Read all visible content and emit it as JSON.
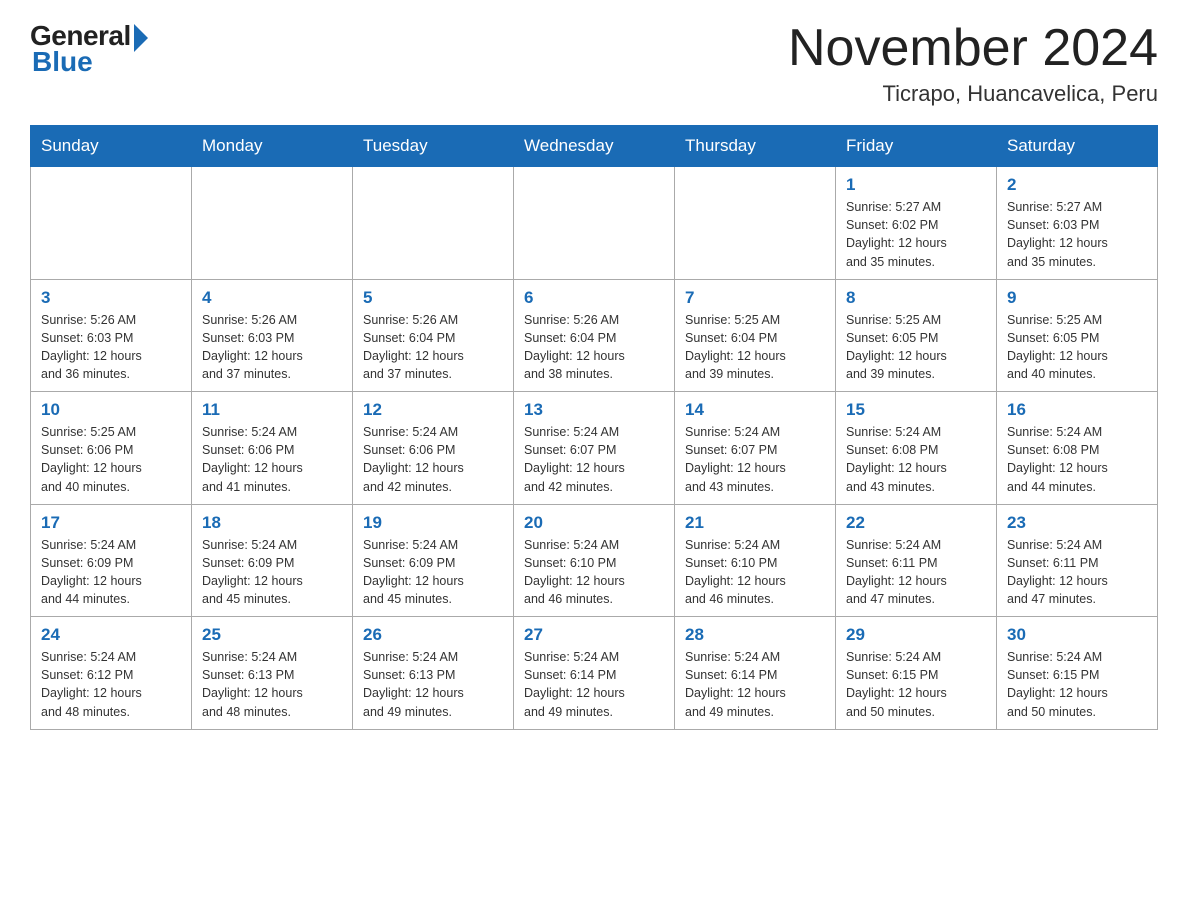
{
  "header": {
    "logo_general": "General",
    "logo_blue": "Blue",
    "month_year": "November 2024",
    "location": "Ticrapo, Huancavelica, Peru"
  },
  "weekdays": [
    "Sunday",
    "Monday",
    "Tuesday",
    "Wednesday",
    "Thursday",
    "Friday",
    "Saturday"
  ],
  "weeks": [
    [
      {
        "day": "",
        "info": ""
      },
      {
        "day": "",
        "info": ""
      },
      {
        "day": "",
        "info": ""
      },
      {
        "day": "",
        "info": ""
      },
      {
        "day": "",
        "info": ""
      },
      {
        "day": "1",
        "info": "Sunrise: 5:27 AM\nSunset: 6:02 PM\nDaylight: 12 hours\nand 35 minutes."
      },
      {
        "day": "2",
        "info": "Sunrise: 5:27 AM\nSunset: 6:03 PM\nDaylight: 12 hours\nand 35 minutes."
      }
    ],
    [
      {
        "day": "3",
        "info": "Sunrise: 5:26 AM\nSunset: 6:03 PM\nDaylight: 12 hours\nand 36 minutes."
      },
      {
        "day": "4",
        "info": "Sunrise: 5:26 AM\nSunset: 6:03 PM\nDaylight: 12 hours\nand 37 minutes."
      },
      {
        "day": "5",
        "info": "Sunrise: 5:26 AM\nSunset: 6:04 PM\nDaylight: 12 hours\nand 37 minutes."
      },
      {
        "day": "6",
        "info": "Sunrise: 5:26 AM\nSunset: 6:04 PM\nDaylight: 12 hours\nand 38 minutes."
      },
      {
        "day": "7",
        "info": "Sunrise: 5:25 AM\nSunset: 6:04 PM\nDaylight: 12 hours\nand 39 minutes."
      },
      {
        "day": "8",
        "info": "Sunrise: 5:25 AM\nSunset: 6:05 PM\nDaylight: 12 hours\nand 39 minutes."
      },
      {
        "day": "9",
        "info": "Sunrise: 5:25 AM\nSunset: 6:05 PM\nDaylight: 12 hours\nand 40 minutes."
      }
    ],
    [
      {
        "day": "10",
        "info": "Sunrise: 5:25 AM\nSunset: 6:06 PM\nDaylight: 12 hours\nand 40 minutes."
      },
      {
        "day": "11",
        "info": "Sunrise: 5:24 AM\nSunset: 6:06 PM\nDaylight: 12 hours\nand 41 minutes."
      },
      {
        "day": "12",
        "info": "Sunrise: 5:24 AM\nSunset: 6:06 PM\nDaylight: 12 hours\nand 42 minutes."
      },
      {
        "day": "13",
        "info": "Sunrise: 5:24 AM\nSunset: 6:07 PM\nDaylight: 12 hours\nand 42 minutes."
      },
      {
        "day": "14",
        "info": "Sunrise: 5:24 AM\nSunset: 6:07 PM\nDaylight: 12 hours\nand 43 minutes."
      },
      {
        "day": "15",
        "info": "Sunrise: 5:24 AM\nSunset: 6:08 PM\nDaylight: 12 hours\nand 43 minutes."
      },
      {
        "day": "16",
        "info": "Sunrise: 5:24 AM\nSunset: 6:08 PM\nDaylight: 12 hours\nand 44 minutes."
      }
    ],
    [
      {
        "day": "17",
        "info": "Sunrise: 5:24 AM\nSunset: 6:09 PM\nDaylight: 12 hours\nand 44 minutes."
      },
      {
        "day": "18",
        "info": "Sunrise: 5:24 AM\nSunset: 6:09 PM\nDaylight: 12 hours\nand 45 minutes."
      },
      {
        "day": "19",
        "info": "Sunrise: 5:24 AM\nSunset: 6:09 PM\nDaylight: 12 hours\nand 45 minutes."
      },
      {
        "day": "20",
        "info": "Sunrise: 5:24 AM\nSunset: 6:10 PM\nDaylight: 12 hours\nand 46 minutes."
      },
      {
        "day": "21",
        "info": "Sunrise: 5:24 AM\nSunset: 6:10 PM\nDaylight: 12 hours\nand 46 minutes."
      },
      {
        "day": "22",
        "info": "Sunrise: 5:24 AM\nSunset: 6:11 PM\nDaylight: 12 hours\nand 47 minutes."
      },
      {
        "day": "23",
        "info": "Sunrise: 5:24 AM\nSunset: 6:11 PM\nDaylight: 12 hours\nand 47 minutes."
      }
    ],
    [
      {
        "day": "24",
        "info": "Sunrise: 5:24 AM\nSunset: 6:12 PM\nDaylight: 12 hours\nand 48 minutes."
      },
      {
        "day": "25",
        "info": "Sunrise: 5:24 AM\nSunset: 6:13 PM\nDaylight: 12 hours\nand 48 minutes."
      },
      {
        "day": "26",
        "info": "Sunrise: 5:24 AM\nSunset: 6:13 PM\nDaylight: 12 hours\nand 49 minutes."
      },
      {
        "day": "27",
        "info": "Sunrise: 5:24 AM\nSunset: 6:14 PM\nDaylight: 12 hours\nand 49 minutes."
      },
      {
        "day": "28",
        "info": "Sunrise: 5:24 AM\nSunset: 6:14 PM\nDaylight: 12 hours\nand 49 minutes."
      },
      {
        "day": "29",
        "info": "Sunrise: 5:24 AM\nSunset: 6:15 PM\nDaylight: 12 hours\nand 50 minutes."
      },
      {
        "day": "30",
        "info": "Sunrise: 5:24 AM\nSunset: 6:15 PM\nDaylight: 12 hours\nand 50 minutes."
      }
    ]
  ]
}
